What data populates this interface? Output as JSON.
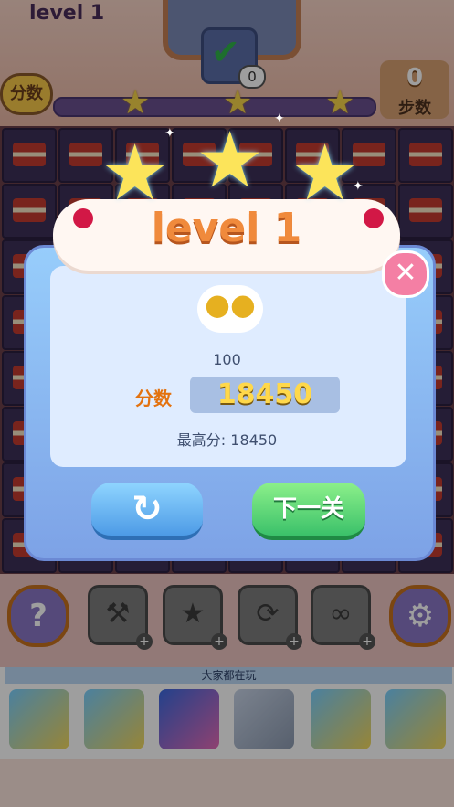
{
  "header": {
    "level_label": "level 1",
    "move_check_count": "0",
    "score_badge": "分数",
    "steps_value": "0",
    "steps_label": "步数"
  },
  "dialog": {
    "title": "level 1",
    "coin_amount": "100",
    "score_label": "分数",
    "score_value": "18450",
    "best_score": "最高分: 18450",
    "next_label": "下一关",
    "retry_icon": "refresh-icon",
    "close_icon": "close-icon"
  },
  "toolbar": {
    "help_glyph": "?",
    "tools": [
      "hammer-icon",
      "wand-icon",
      "shuffle-icon",
      "infinity-icon"
    ]
  },
  "ads": {
    "title": "大家都在玩"
  },
  "colors": {
    "dialog_blue": "#97cdfb",
    "next_green": "#3bc16a",
    "retry_blue": "#4d9be6",
    "title_orange": "#f08a3c",
    "score_yellow": "#ffd84a"
  }
}
